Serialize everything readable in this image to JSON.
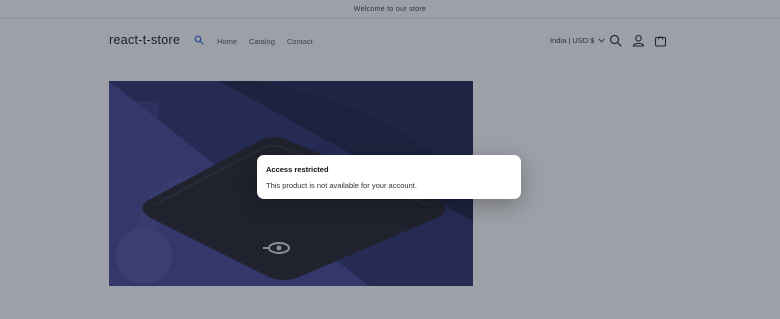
{
  "announcement": {
    "text": "Welcome to our store"
  },
  "header": {
    "logo": "react-t-store",
    "nav": [
      {
        "label": "Home"
      },
      {
        "label": "Catalog"
      },
      {
        "label": "Contact"
      }
    ],
    "locale": "India | USD $"
  },
  "icons": {
    "nav_search": "search-icon",
    "search": "search-icon",
    "account": "user-icon",
    "cart": "bag-icon",
    "locale_chevron": "chevron-down-icon"
  },
  "modal": {
    "title": "Access restricted",
    "body": "This product is not available for your account."
  },
  "colors": {
    "overlay": "#282c3e",
    "product_bg": "#3b3f8a",
    "mousepad": "#1b1c22",
    "brand_search_icon": "#3b6fd1"
  }
}
